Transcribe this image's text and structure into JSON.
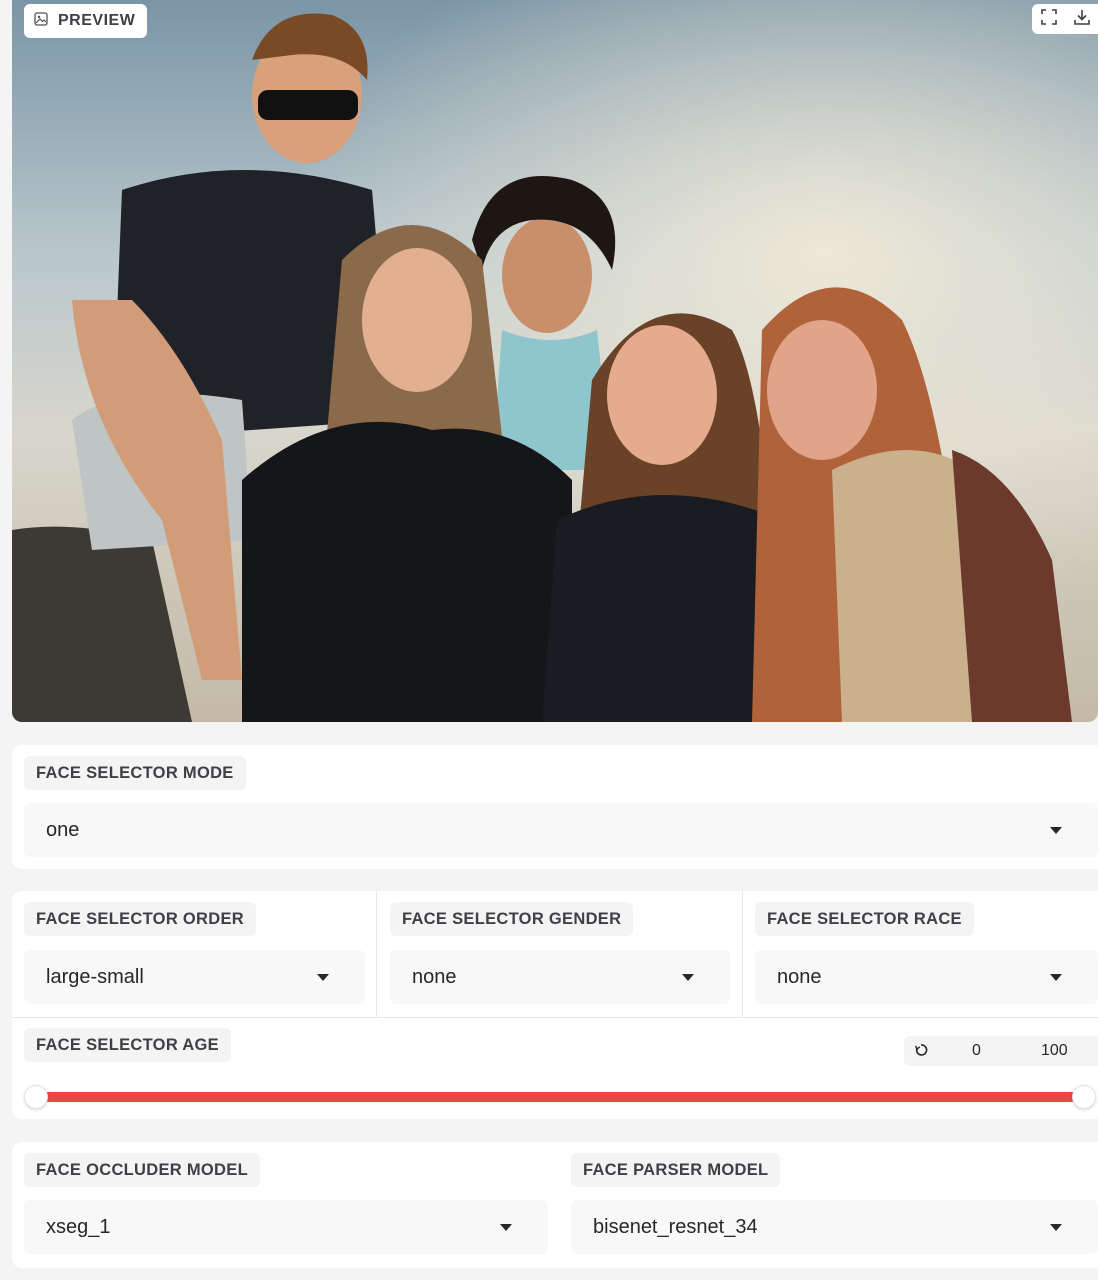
{
  "preview": {
    "label": "PREVIEW",
    "icon": "image-icon",
    "tools": [
      "fullscreen-icon",
      "download-icon"
    ]
  },
  "face_selector_mode": {
    "label": "FACE SELECTOR MODE",
    "value": "one"
  },
  "face_selector_order": {
    "label": "FACE SELECTOR ORDER",
    "value": "large-small"
  },
  "face_selector_gender": {
    "label": "FACE SELECTOR GENDER",
    "value": "none"
  },
  "face_selector_race": {
    "label": "FACE SELECTOR RACE",
    "value": "none"
  },
  "face_selector_age": {
    "label": "FACE SELECTOR AGE",
    "reset_icon": "reset-icon",
    "min_value": "0",
    "max_value": "100"
  },
  "face_occluder_model": {
    "label": "FACE OCCLUDER MODEL",
    "value": "xseg_1"
  },
  "face_parser_model": {
    "label": "FACE PARSER MODEL",
    "value": "bisenet_resnet_34"
  },
  "colors": {
    "accent": "#ef4444",
    "panel": "#ffffff",
    "background": "#f4f4f5"
  }
}
